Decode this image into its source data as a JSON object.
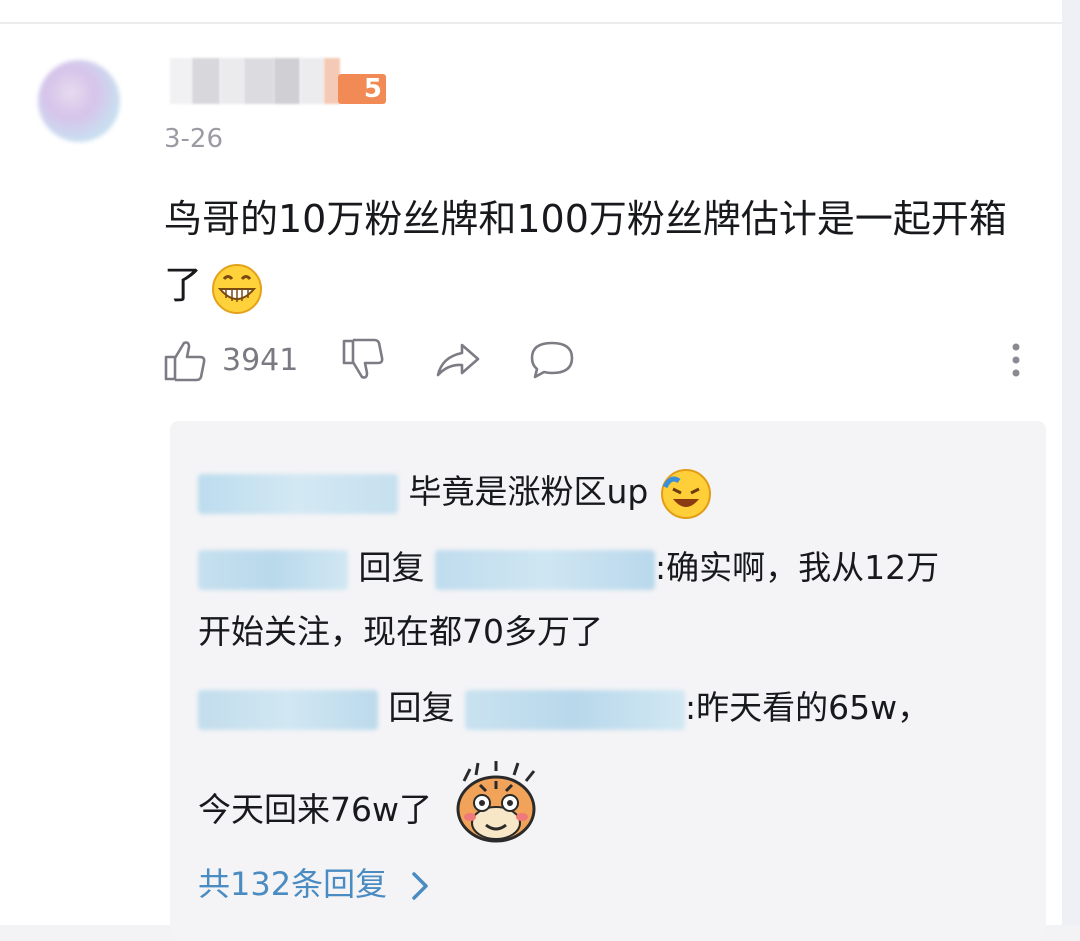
{
  "comment": {
    "level_badge_text": "5",
    "date": "3-26",
    "text": "鸟哥的10万粉丝牌和100万粉丝牌估计是一起开箱了",
    "emoji_icon": "grinning-face-icon",
    "likes": "3941"
  },
  "replies": [
    {
      "author_prefix": "",
      "body": "毕竟是涨粉区up",
      "emoji_icon": "laughing-tears-icon"
    },
    {
      "reply_word": "回复",
      "body": ":确实啊，我从12万",
      "body_cont": "开始关注，现在都70多万了"
    },
    {
      "reply_word": "回复",
      "body": ":昨天看的65w，",
      "body_cont": "今天回来76w了",
      "emoji_icon": "tiger-sticker-icon"
    }
  ],
  "more_replies": "共132条回复",
  "colors": {
    "link": "#4a8cc2",
    "badge": "#f18a55",
    "text": "#18191c",
    "meta": "#9b9ba3"
  }
}
